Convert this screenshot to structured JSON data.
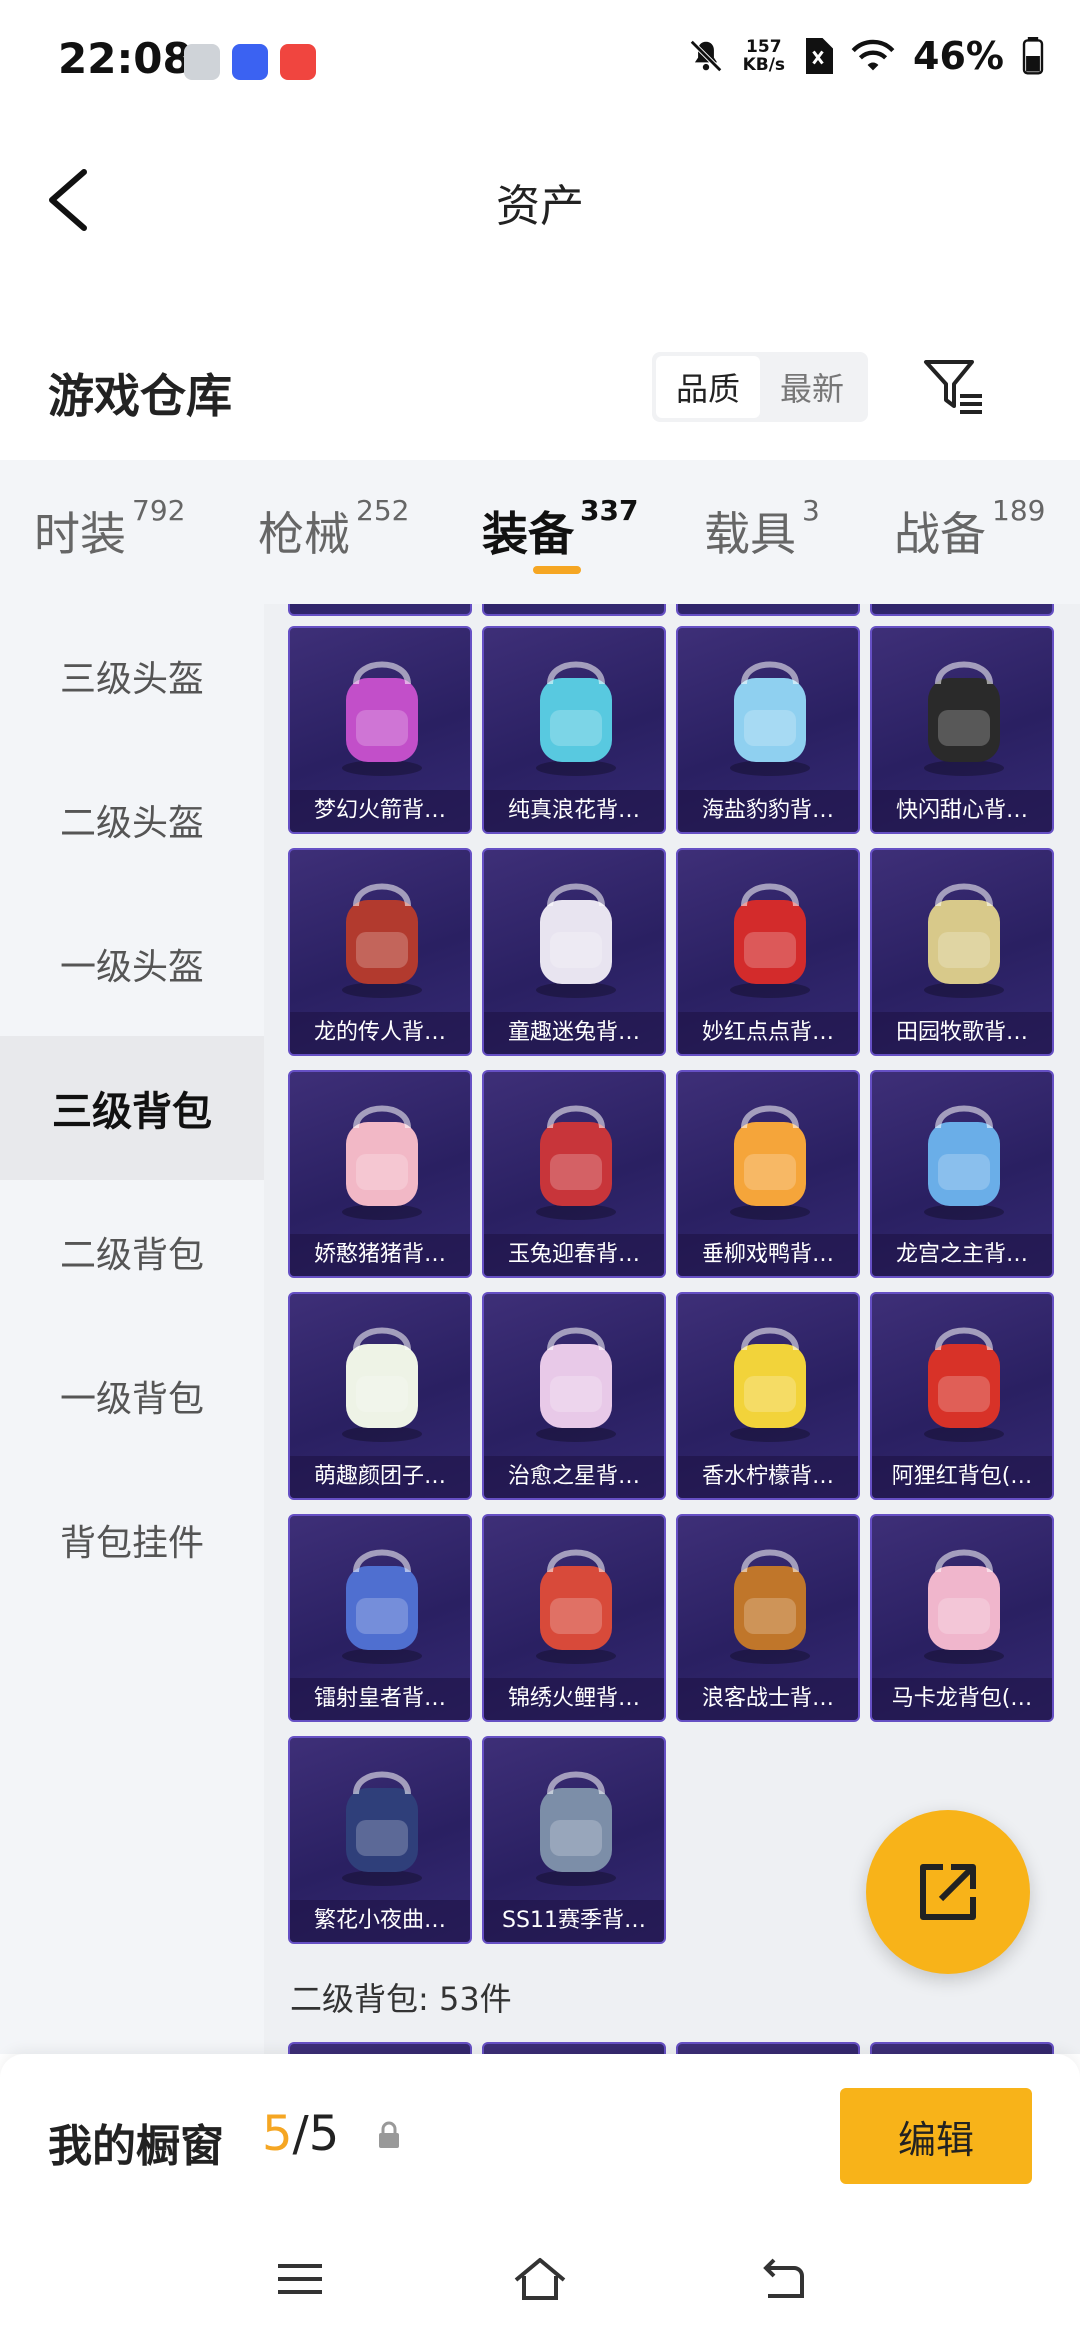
{
  "status_bar": {
    "time": "22:08",
    "net_speed_value": "157",
    "net_speed_unit": "KB/s",
    "battery": "46%"
  },
  "header": {
    "title": "资产"
  },
  "warehouse": {
    "title": "游戏仓库",
    "sort_options": [
      "品质",
      "最新"
    ],
    "selected_sort": "品质"
  },
  "tabs": [
    {
      "label": "时装",
      "count": "792"
    },
    {
      "label": "枪械",
      "count": "252"
    },
    {
      "label": "装备",
      "count": "337"
    },
    {
      "label": "载具",
      "count": "3"
    },
    {
      "label": "战备",
      "count": "189"
    }
  ],
  "active_tab": "装备",
  "sidebar": {
    "items": [
      "三级头盔",
      "二级头盔",
      "一级头盔",
      "三级背包",
      "二级背包",
      "一级背包",
      "背包挂件"
    ],
    "active": "三级背包"
  },
  "grid": {
    "items": [
      {
        "name": "梦幻火箭背…",
        "icon": "rocket-backpack-icon",
        "color": "#c24fc9"
      },
      {
        "name": "纯真浪花背…",
        "icon": "wave-backpack-icon",
        "color": "#58c9e0"
      },
      {
        "name": "海盐豹豹背…",
        "icon": "seal-backpack-icon",
        "color": "#8fd0f0"
      },
      {
        "name": "快闪甜心背…",
        "icon": "sweetheart-backpack-icon",
        "color": "#2a2a2a"
      },
      {
        "name": "龙的传人背…",
        "icon": "dragon-backpack-icon",
        "color": "#b23a2e"
      },
      {
        "name": "童趣迷兔背…",
        "icon": "bunny-backpack-icon",
        "color": "#e8e4f0"
      },
      {
        "name": "妙红点点背…",
        "icon": "ladybug-backpack-icon",
        "color": "#d32b2b"
      },
      {
        "name": "田园牧歌背…",
        "icon": "basket-backpack-icon",
        "color": "#d8c98a"
      },
      {
        "name": "娇憨猪猪背…",
        "icon": "pig-backpack-icon",
        "color": "#f2b8c6"
      },
      {
        "name": "玉兔迎春背…",
        "icon": "rabbit-backpack-icon",
        "color": "#c8353a"
      },
      {
        "name": "垂柳戏鸭背…",
        "icon": "duck-backpack-icon",
        "color": "#f5a53a"
      },
      {
        "name": "龙宫之主背…",
        "icon": "palace-backpack-icon",
        "color": "#6aaee8"
      },
      {
        "name": "萌趣颜团子…",
        "icon": "dumpling-backpack-icon",
        "color": "#eef3e6"
      },
      {
        "name": "治愈之星背…",
        "icon": "star-backpack-icon",
        "color": "#e8c9e8"
      },
      {
        "name": "香水柠檬背…",
        "icon": "lemon-backpack-icon",
        "color": "#f2d33a"
      },
      {
        "name": "阿狸红背包(…",
        "icon": "fox-backpack-icon",
        "color": "#d83228"
      },
      {
        "name": "镭射皇者背…",
        "icon": "laser-backpack-icon",
        "color": "#4f6fd0"
      },
      {
        "name": "锦绣火鲤背…",
        "icon": "koi-backpack-icon",
        "color": "#d84a3a"
      },
      {
        "name": "浪客战士背…",
        "icon": "warrior-backpack-icon",
        "color": "#c0762a"
      },
      {
        "name": "马卡龙背包(…",
        "icon": "macaron-backpack-icon",
        "color": "#f0b6cc"
      },
      {
        "name": "繁花小夜曲…",
        "icon": "flower-backpack-icon",
        "color": "#2f3f7a"
      },
      {
        "name": "SS11赛季背…",
        "icon": "season-backpack-icon",
        "color": "#7c8ea8"
      }
    ]
  },
  "section_footer": "二级背包: 53件",
  "showcase": {
    "title": "我的橱窗",
    "count_current": "5",
    "count_sep_total": "/5",
    "edit_label": "编辑"
  },
  "colors": {
    "accent": "#f8b319",
    "card_bg": "#2a2062",
    "card_border": "#6650c4"
  }
}
